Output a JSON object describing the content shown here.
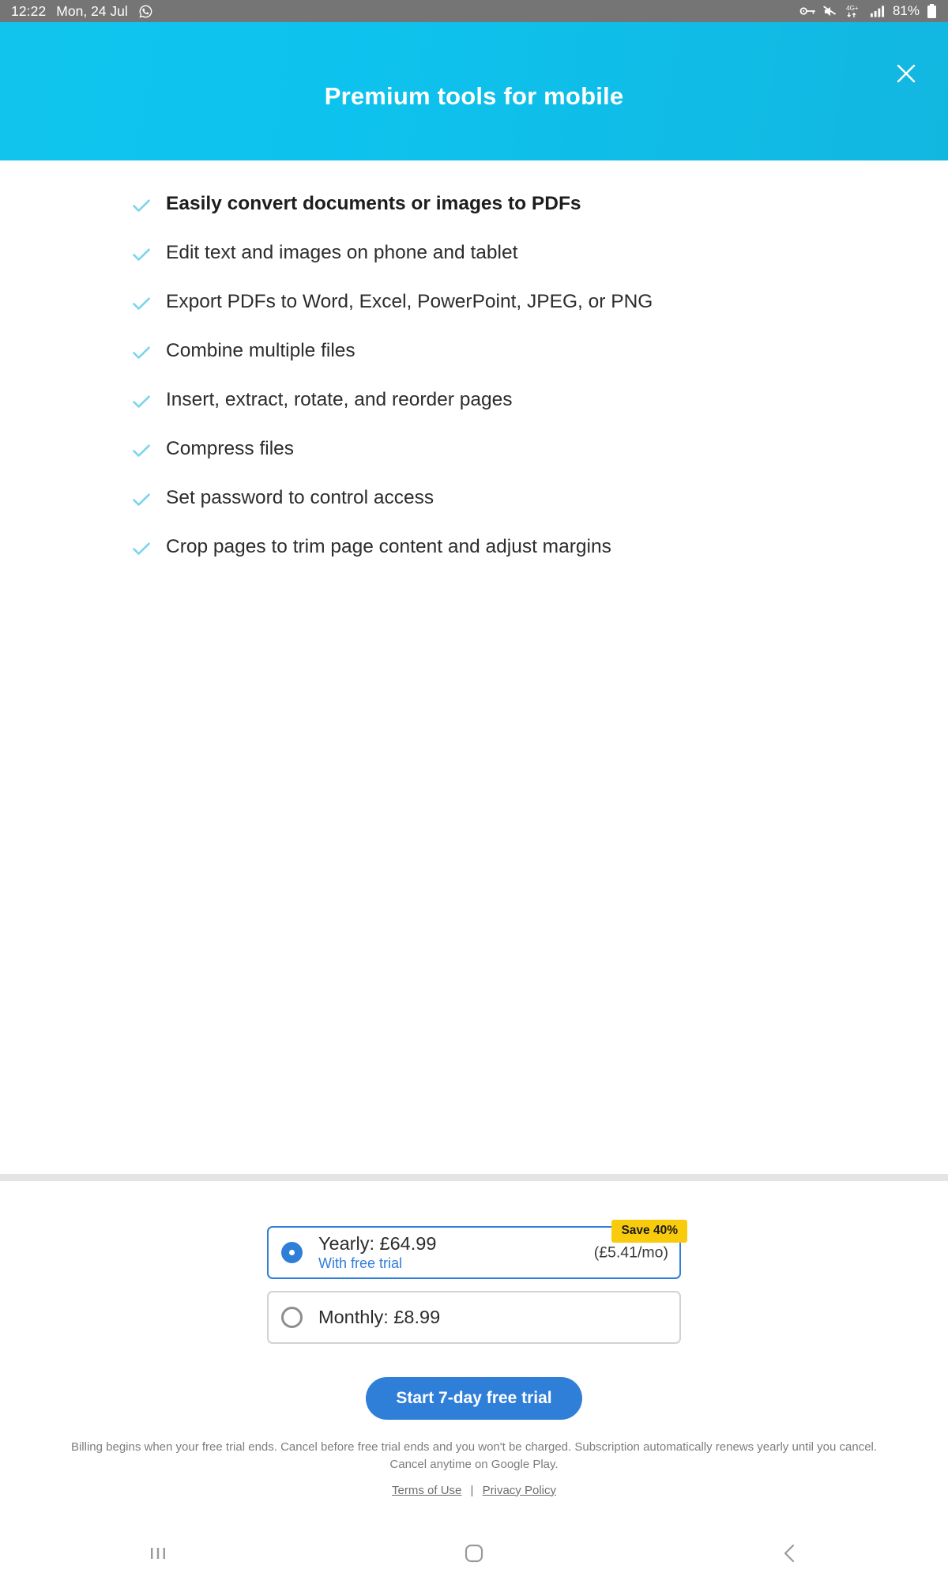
{
  "status_bar": {
    "time": "12:22",
    "date": "Mon, 24 Jul",
    "app_icon": "whatsapp-icon",
    "icons": [
      "vpn-key-icon",
      "mute-icon",
      "4g-plus-data-icon",
      "signal-bars-icon"
    ],
    "battery_percent": "81%",
    "network_label": "4G+"
  },
  "header": {
    "title": "Premium tools for mobile",
    "close_label": "close-icon",
    "gradient_start": "#10c4ed",
    "gradient_end": "#12b7e0"
  },
  "features": {
    "check_color": "#79d4ec",
    "items": [
      {
        "text": "Easily convert documents or images to PDFs",
        "bold": true
      },
      {
        "text": "Edit text and images on phone and tablet",
        "bold": false
      },
      {
        "text": "Export PDFs to Word, Excel, PowerPoint, JPEG, or PNG",
        "bold": false
      },
      {
        "text": "Combine multiple files",
        "bold": false
      },
      {
        "text": "Insert, extract, rotate, and reorder pages",
        "bold": false
      },
      {
        "text": "Compress files",
        "bold": false
      },
      {
        "text": "Set password to control access",
        "bold": false
      },
      {
        "text": "Crop pages to trim page content and adjust margins",
        "bold": false
      }
    ]
  },
  "pricing": {
    "badge": "Save 40%",
    "badge_color": "#f9cb0d",
    "accent_color": "#2f7ed8",
    "plans": [
      {
        "title": "Yearly: £64.99",
        "subtitle": "With free trial",
        "right_note": "(£5.41/mo)",
        "selected": true
      },
      {
        "title": "Monthly: £8.99",
        "subtitle": "",
        "right_note": "",
        "selected": false
      }
    ],
    "cta_label": "Start 7-day free trial",
    "legal": "Billing begins when your free trial ends. Cancel before free trial ends and you won't be charged. Subscription automatically renews yearly until you cancel. Cancel anytime on Google Play.",
    "terms_label": "Terms of Use",
    "privacy_label": "Privacy Policy",
    "link_separator": "|"
  },
  "navigation": {
    "recents_label": "recents-icon",
    "home_label": "home-icon",
    "back_label": "back-icon"
  }
}
